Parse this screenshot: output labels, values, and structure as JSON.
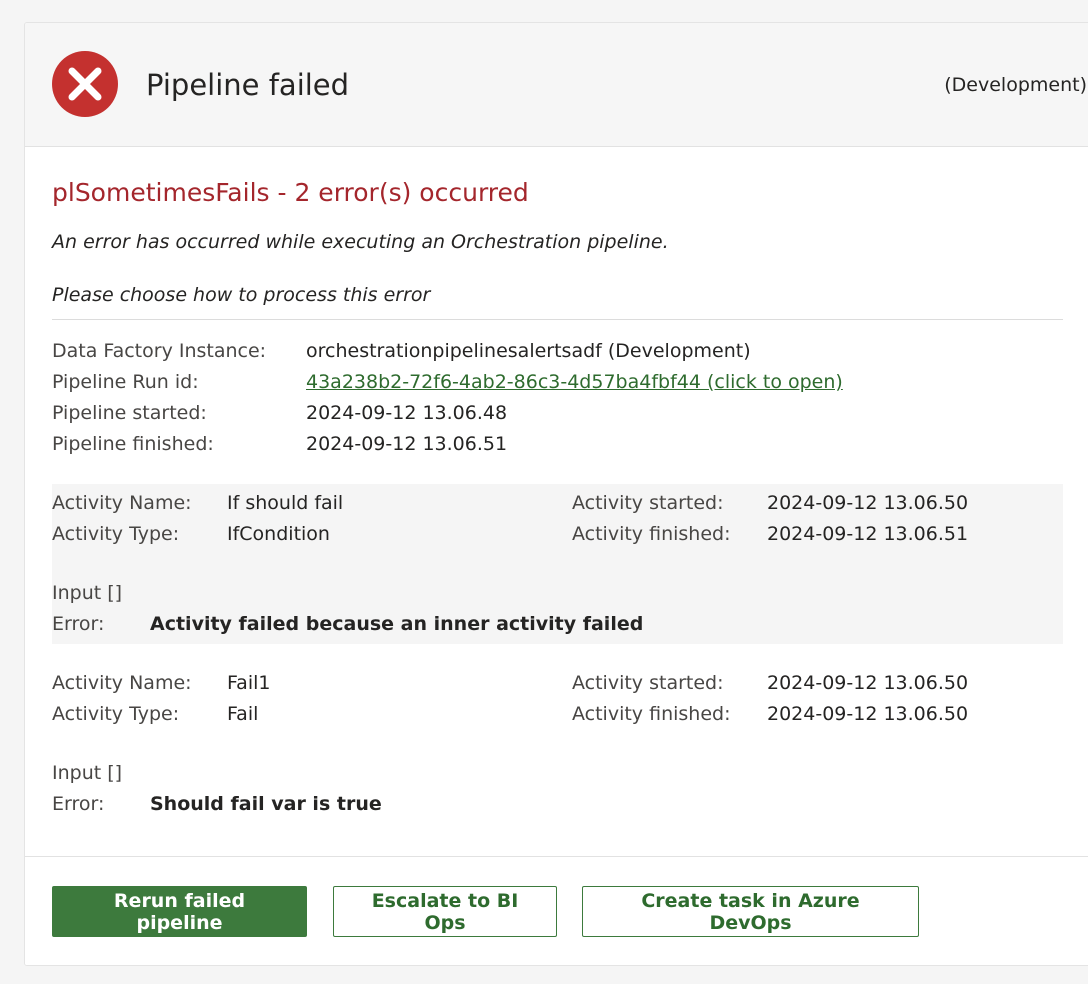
{
  "header": {
    "title": "Pipeline failed",
    "environment": "(Development)"
  },
  "error": {
    "heading": "plSometimesFails - 2 error(s) occurred",
    "intro": "An error has occurred while executing an Orchestration pipeline.",
    "prompt": "Please choose how to process this error"
  },
  "pipeline": {
    "instance_label": "Data Factory Instance:",
    "instance_value": "orchestrationpipelinesalertsadf (Development)",
    "run_id_label": "Pipeline Run id:",
    "run_id_value": "43a238b2-72f6-4ab2-86c3-4d57ba4fbf44 (click to open)",
    "started_label": "Pipeline started:",
    "started_value": "2024-09-12 13.06.48",
    "finished_label": "Pipeline finished:",
    "finished_value": "2024-09-12 13.06.51"
  },
  "activities": [
    {
      "name_label": "Activity Name:",
      "name": "If should fail",
      "type_label": "Activity Type:",
      "type": "IfCondition",
      "started_label": "Activity started:",
      "started": "2024-09-12 13.06.50",
      "finished_label": "Activity finished:",
      "finished": "2024-09-12 13.06.51",
      "input": "Input []",
      "error_label": "Error:",
      "error": "Activity failed because an inner activity failed"
    },
    {
      "name_label": "Activity Name:",
      "name": "Fail1",
      "type_label": "Activity Type:",
      "type": "Fail",
      "started_label": "Activity started:",
      "started": "2024-09-12 13.06.50",
      "finished_label": "Activity finished:",
      "finished": "2024-09-12 13.06.50",
      "input": "Input []",
      "error_label": "Error:",
      "error": "Should fail var is true"
    }
  ],
  "actions": {
    "rerun": "Rerun failed pipeline",
    "escalate": "Escalate to BI Ops",
    "create_task": "Create task in Azure DevOps"
  },
  "colors": {
    "error_red": "#a4262c",
    "icon_red": "#c4312f",
    "accent_green": "#3d7a3d"
  },
  "icons": {
    "status": "error-x-circle-icon"
  }
}
